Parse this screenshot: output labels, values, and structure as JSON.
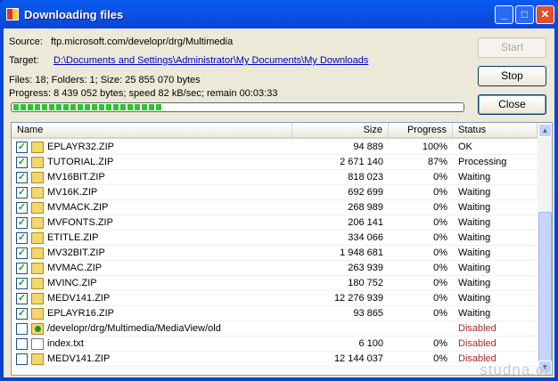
{
  "window": {
    "title": "Downloading files"
  },
  "source": {
    "label": "Source:",
    "value": "ftp.microsoft.com/developr/drg/Multimedia"
  },
  "target": {
    "label": "Target:",
    "value": "D:\\Documents and Settings\\Administrator\\My Documents\\My Downloads"
  },
  "summary": "Files: 18; Folders: 1;  Size: 25 855 070 bytes",
  "progress": {
    "text": "Progress: 8 439 052 bytes; speed 82 kB/sec; remain 00:03:33",
    "fraction": 0.33
  },
  "buttons": {
    "start": "Start",
    "stop": "Stop",
    "close": "Close"
  },
  "columns": [
    "Name",
    "Size",
    "Progress",
    "Status"
  ],
  "rows": [
    {
      "checked": true,
      "icon": "zip",
      "name": "EPLAYR32.ZIP",
      "size": "94 889",
      "progress": "100%",
      "status": "OK"
    },
    {
      "checked": true,
      "icon": "zip",
      "name": "TUTORIAL.ZIP",
      "size": "2 671 140",
      "progress": "87%",
      "status": "Processing"
    },
    {
      "checked": true,
      "icon": "zip",
      "name": "MV16BIT.ZIP",
      "size": "818 023",
      "progress": "0%",
      "status": "Waiting"
    },
    {
      "checked": true,
      "icon": "zip",
      "name": "MV16K.ZIP",
      "size": "692 699",
      "progress": "0%",
      "status": "Waiting"
    },
    {
      "checked": true,
      "icon": "zip",
      "name": "MVMACK.ZIP",
      "size": "268 989",
      "progress": "0%",
      "status": "Waiting"
    },
    {
      "checked": true,
      "icon": "zip",
      "name": "MVFONTS.ZIP",
      "size": "206 141",
      "progress": "0%",
      "status": "Waiting"
    },
    {
      "checked": true,
      "icon": "zip",
      "name": "ETITLE.ZIP",
      "size": "334 066",
      "progress": "0%",
      "status": "Waiting"
    },
    {
      "checked": true,
      "icon": "zip",
      "name": "MV32BIT.ZIP",
      "size": "1 948 681",
      "progress": "0%",
      "status": "Waiting"
    },
    {
      "checked": true,
      "icon": "zip",
      "name": "MVMAC.ZIP",
      "size": "263 939",
      "progress": "0%",
      "status": "Waiting"
    },
    {
      "checked": true,
      "icon": "zip",
      "name": "MVINC.ZIP",
      "size": "180 752",
      "progress": "0%",
      "status": "Waiting"
    },
    {
      "checked": true,
      "icon": "zip",
      "name": "MEDV141.ZIP",
      "size": "12 276 939",
      "progress": "0%",
      "status": "Waiting"
    },
    {
      "checked": true,
      "icon": "zip",
      "name": "EPLAYR16.ZIP",
      "size": "93 865",
      "progress": "0%",
      "status": "Waiting"
    },
    {
      "checked": false,
      "icon": "dir",
      "name": "/developr/drg/Multimedia/MediaView/old",
      "size": "",
      "progress": "",
      "status": "Disabled"
    },
    {
      "checked": false,
      "icon": "txt",
      "name": "index.txt",
      "size": "6 100",
      "progress": "0%",
      "status": "Disabled"
    },
    {
      "checked": false,
      "icon": "zip",
      "name": "MEDV141.ZIP",
      "size": "12 144 037",
      "progress": "0%",
      "status": "Disabled"
    }
  ],
  "watermark": "studna.cz"
}
